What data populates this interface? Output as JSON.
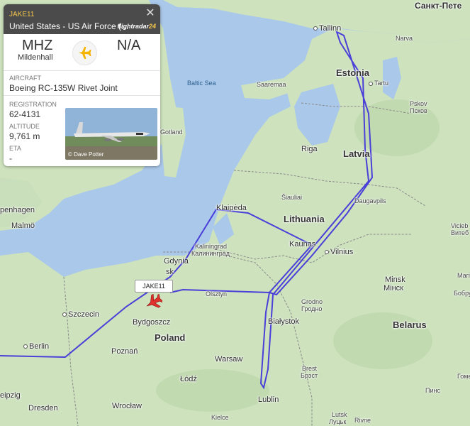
{
  "map": {
    "labels": [
      {
        "id": "sankt-peterburg",
        "text": "Санкт-Пете",
        "type": "city"
      },
      {
        "id": "tallinn",
        "text": "Tallinn",
        "type": "city"
      },
      {
        "id": "narva",
        "text": "Narva",
        "type": "small"
      },
      {
        "id": "estonia",
        "text": "Estonia",
        "type": "country"
      },
      {
        "id": "saaremaa",
        "text": "Saaremaa",
        "type": "small"
      },
      {
        "id": "tartu",
        "text": "Tartu",
        "type": "small"
      },
      {
        "id": "pskov",
        "text": "Pskov",
        "type": "small"
      },
      {
        "id": "pskov-ru",
        "text": "Псков",
        "type": "small"
      },
      {
        "id": "baltic-sea",
        "text": "Baltic Sea",
        "type": "sea"
      },
      {
        "id": "riga",
        "text": "Riga",
        "type": "city"
      },
      {
        "id": "latvia",
        "text": "Latvia",
        "type": "country"
      },
      {
        "id": "gotland",
        "text": "Gotland",
        "type": "small"
      },
      {
        "id": "siauliai",
        "text": "Šiauliai",
        "type": "small"
      },
      {
        "id": "daugavpils",
        "text": "Daugavpils",
        "type": "small"
      },
      {
        "id": "klaipeda",
        "text": "Klaipėda",
        "type": "city"
      },
      {
        "id": "lithuania",
        "text": "Lithuania",
        "type": "country"
      },
      {
        "id": "copenhagen",
        "text": "penhagen",
        "type": "city"
      },
      {
        "id": "malmo",
        "text": "Malmö",
        "type": "city"
      },
      {
        "id": "kaliningrad",
        "text": "Kaliningrad",
        "type": "small"
      },
      {
        "id": "kaliningrad-ru",
        "text": "Калининград",
        "type": "small"
      },
      {
        "id": "kaunas",
        "text": "Kaunas",
        "type": "city"
      },
      {
        "id": "vilnius",
        "text": "Vilnius",
        "type": "city"
      },
      {
        "id": "vitebsk",
        "text": "Vicieb",
        "type": "small"
      },
      {
        "id": "vitebsk-ru",
        "text": "Витеб",
        "type": "small"
      },
      {
        "id": "gdynia",
        "text": "Gdynia",
        "type": "city"
      },
      {
        "id": "gdansk",
        "text": "sk",
        "type": "city"
      },
      {
        "id": "olsztyn",
        "text": "Olsztyn",
        "type": "small"
      },
      {
        "id": "minsk",
        "text": "Minsk",
        "type": "city"
      },
      {
        "id": "minsk-ru",
        "text": "Мінск",
        "type": "city"
      },
      {
        "id": "szczecin",
        "text": "Szczecin",
        "type": "city"
      },
      {
        "id": "bialystok",
        "text": "Białystok",
        "type": "city"
      },
      {
        "id": "grodno",
        "text": "Grodno",
        "type": "small"
      },
      {
        "id": "grodno-ru",
        "text": "Гродно",
        "type": "small"
      },
      {
        "id": "bydgoszcz",
        "text": "Bydgoszcz",
        "type": "city"
      },
      {
        "id": "poland",
        "text": "Poland",
        "type": "country"
      },
      {
        "id": "belarus",
        "text": "Belarus",
        "type": "country"
      },
      {
        "id": "berlin",
        "text": "Berlin",
        "type": "city"
      },
      {
        "id": "poznan",
        "text": "Poznań",
        "type": "city"
      },
      {
        "id": "warsaw",
        "text": "Warsaw",
        "type": "city"
      },
      {
        "id": "lodz",
        "text": "Łódź",
        "type": "city"
      },
      {
        "id": "brest",
        "text": "Brest",
        "type": "small"
      },
      {
        "id": "brest-ru",
        "text": "Брэст",
        "type": "small"
      },
      {
        "id": "leipzig",
        "text": "eipzig",
        "type": "city"
      },
      {
        "id": "dresden",
        "text": "Dresden",
        "type": "city"
      },
      {
        "id": "wroclaw",
        "text": "Wrocław",
        "type": "city"
      },
      {
        "id": "lublin",
        "text": "Lublin",
        "type": "city"
      },
      {
        "id": "kielce",
        "text": "Kielce",
        "type": "small"
      },
      {
        "id": "lutsk",
        "text": "Lutsk",
        "type": "small"
      },
      {
        "id": "lutsk-ua",
        "text": "Луцьк",
        "type": "small"
      },
      {
        "id": "rivne",
        "text": "Rivne",
        "type": "small"
      },
      {
        "id": "bobruisk",
        "text": "Бобру",
        "type": "small"
      },
      {
        "id": "mogilev",
        "text": "Магіл",
        "type": "small"
      },
      {
        "id": "gomel",
        "text": "Гомел",
        "type": "small"
      },
      {
        "id": "pinsk",
        "text": "Пинс",
        "type": "small"
      }
    ]
  },
  "flight_card": {
    "callsign": "JAKE11",
    "operator": "United States - US Air Force (...",
    "logo_text": "flightradar",
    "logo_accent": "24",
    "close_icon": "close-icon",
    "origin_code": "MHZ",
    "origin_name": "Mildenhall",
    "destination_code": "N/A",
    "aircraft_label": "AIRCRAFT",
    "aircraft_value": "Boeing RC-135W Rivet Joint",
    "registration_label": "REGISTRATION",
    "registration_value": "62-4131",
    "altitude_label": "ALTITUDE",
    "altitude_value": "9,761 m",
    "eta_label": "ETA",
    "eta_value": "-",
    "photo_credit": "© Dave Potter"
  },
  "map_flight_label": "JAKE11",
  "colors": {
    "track": "#4a3fd9",
    "aircraft": "#e0312d",
    "accent": "#f5c64a",
    "land": "#cfe3c0",
    "water": "#aac8ea"
  }
}
